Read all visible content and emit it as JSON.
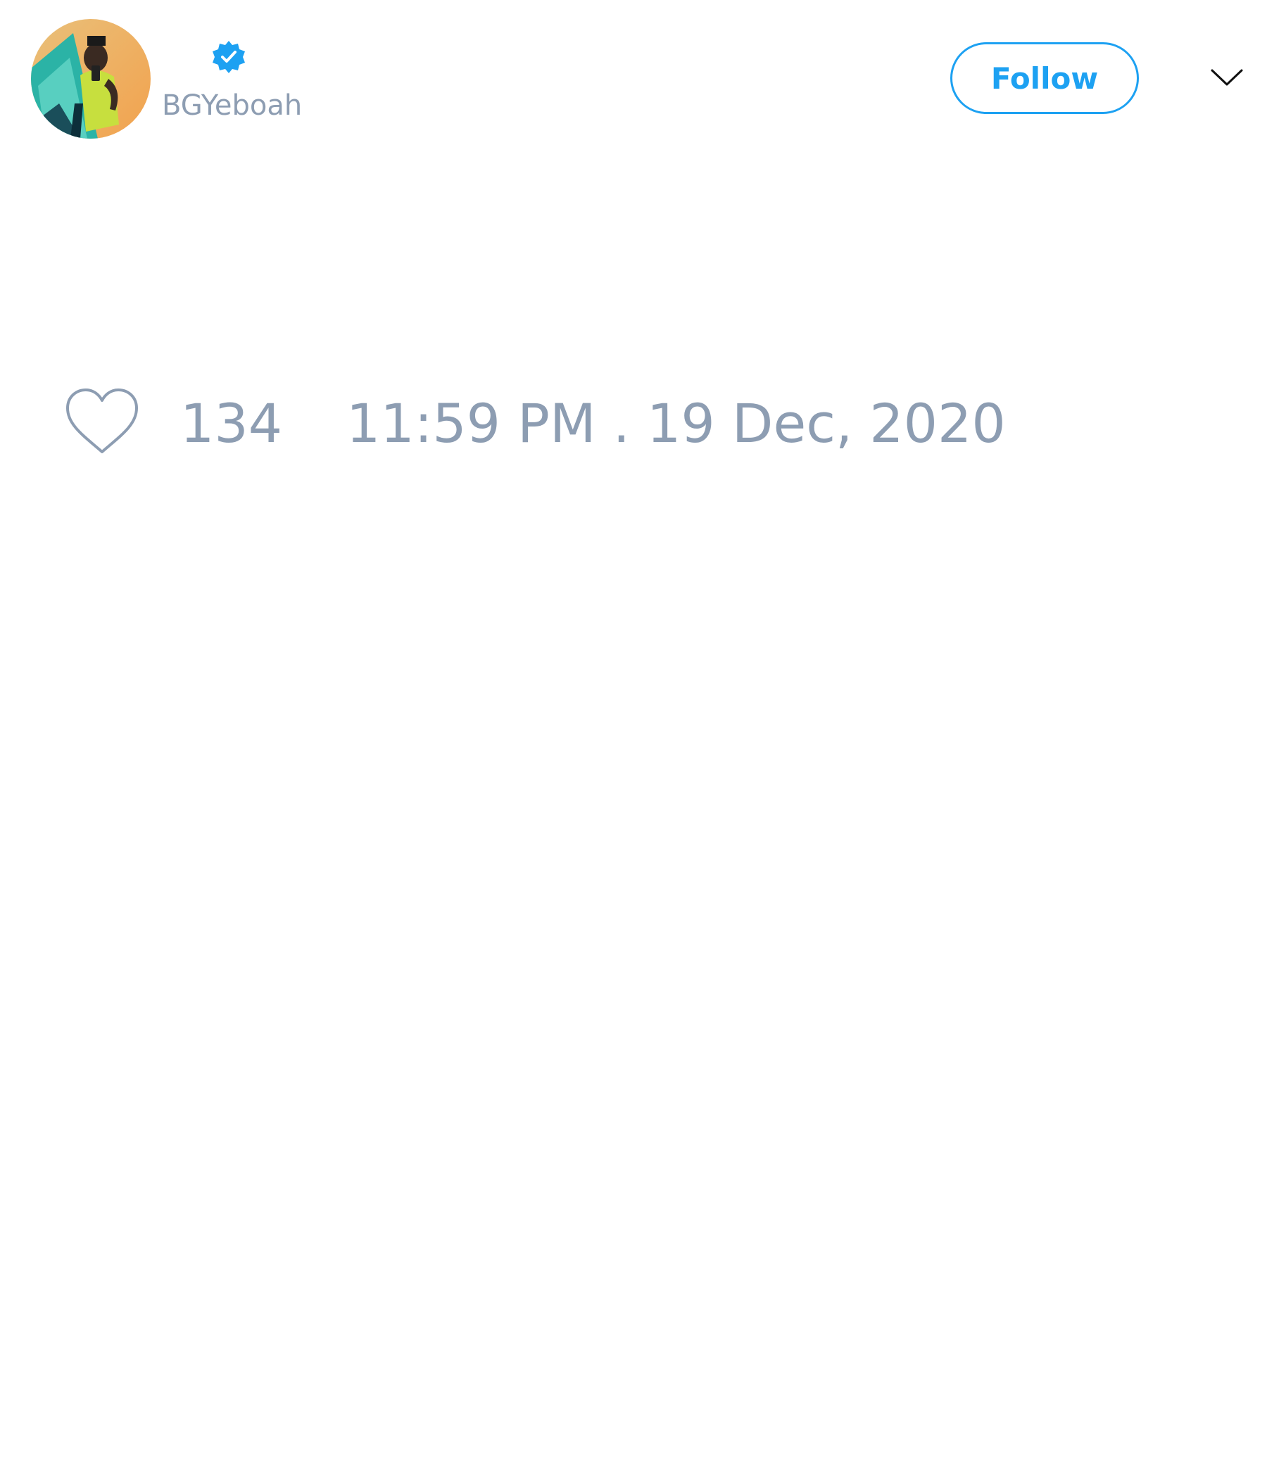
{
  "tweet": {
    "author": {
      "username": "BGYeboah",
      "verified": true,
      "avatar": "profile-photo"
    },
    "follow_label": "Follow",
    "likes": "134",
    "timestamp": "11:59 PM . 19 Dec, 2020"
  },
  "icons": {
    "verified": "verified-badge-icon",
    "more": "chevron-down-icon",
    "like": "heart-icon"
  },
  "colors": {
    "accent": "#1da1f2",
    "muted_text": "#8d9db2"
  }
}
